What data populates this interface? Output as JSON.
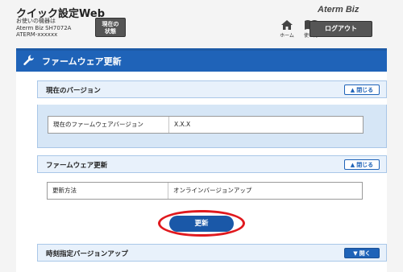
{
  "header": {
    "app_title": "クイック設定Web",
    "device_lines": [
      "お使いの機器は",
      "Aterm Biz SH7072A",
      "ATERM-xxxxxx"
    ],
    "status_button": [
      "現在の",
      "状態"
    ],
    "home_label": "ホーム",
    "help_label": "使い方",
    "brand": "Aterm Biz",
    "logout_label": "ログアウト"
  },
  "panel": {
    "title": "ファームウェア更新",
    "sections": [
      {
        "title": "現在のバージョン",
        "toggle": "閉じる",
        "row_label": "現在のファームウェアバージョン",
        "row_value": "X.X.X"
      },
      {
        "title": "ファームウェア更新",
        "toggle": "閉じる",
        "row_label": "更新方法",
        "row_value": "オンラインバージョンアップ"
      },
      {
        "title": "時刻指定バージョンアップ",
        "toggle": "開く"
      }
    ],
    "update_button": "更新"
  },
  "colors": {
    "accent": "#1f63b8",
    "highlight": "#e0191e"
  }
}
